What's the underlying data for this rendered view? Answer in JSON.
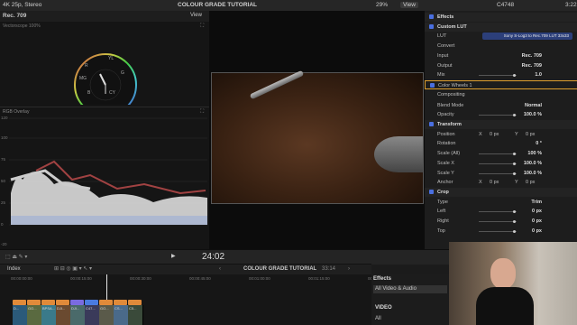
{
  "topbar": {
    "format": "4K 25p, Stereo",
    "title": "COLOUR GRADE TUTORIAL",
    "zoom": "29%",
    "view": "View",
    "clip_id": "C4748",
    "timecode": "3:22"
  },
  "scopes": {
    "label": "Rec. 709",
    "view": "View",
    "vectorscope_label": "Vectorscope 100%",
    "vector_marks": [
      "R",
      "YL",
      "G",
      "CY",
      "B",
      "MG"
    ],
    "rgb_overlay_label": "RGB Overlay",
    "y_ticks": [
      "120",
      "100",
      "75",
      "50",
      "25",
      "0",
      "-20"
    ]
  },
  "inspector": {
    "rows": [
      {
        "label": "Effects",
        "type": "hdr"
      },
      {
        "label": "Custom LUT",
        "type": "check"
      },
      {
        "label": "LUT",
        "value": "Sony S-Log3 to Rec.709 LUT 33x33"
      },
      {
        "label": "Convert",
        "type": "sub"
      },
      {
        "label": "Input",
        "value": "Rec. 709"
      },
      {
        "label": "Output",
        "value": "Rec. 709"
      },
      {
        "label": "Mix",
        "value": "1.0"
      },
      {
        "label": "Color Wheels 1",
        "type": "check-highlight"
      },
      {
        "label": "Compositing",
        "type": "hdr2"
      },
      {
        "label": "Blend Mode",
        "value": "Normal"
      },
      {
        "label": "Opacity",
        "value": "100.0 %"
      },
      {
        "label": "Transform",
        "type": "check"
      },
      {
        "label": "Position",
        "x": "0 px",
        "y": "0 px"
      },
      {
        "label": "Rotation",
        "value": "0 °"
      },
      {
        "label": "Scale (All)",
        "value": "100 %"
      },
      {
        "label": "Scale X",
        "value": "100.0 %"
      },
      {
        "label": "Scale Y",
        "value": "100.0 %"
      },
      {
        "label": "Anchor",
        "x": "0 px",
        "y": "0 px"
      },
      {
        "label": "Crop",
        "type": "check"
      },
      {
        "label": "Type",
        "value": "Trim"
      },
      {
        "label": "Left",
        "value": "0 px"
      },
      {
        "label": "Right",
        "value": "0 px"
      },
      {
        "label": "Top",
        "value": "0 px"
      }
    ]
  },
  "transport": {
    "timecode": "24:02",
    "index": "Index",
    "project": "COLOUR GRADE TUTORIAL",
    "duration": "33:14"
  },
  "ruler": [
    "00:00:00:00",
    "00:00:15:00",
    "00:00:30:00",
    "00:00:45:00",
    "00:01:00:00",
    "00:01:15:00",
    "00:01:30:00"
  ],
  "effects_panel": {
    "title": "Effects",
    "item": "All Video & Audio",
    "section": "VIDEO",
    "all": "All"
  },
  "clips": [
    "D...",
    "GO...",
    "BPSA...",
    "DJI...",
    "DJI...",
    "C47...",
    "GO...",
    "CS...",
    "C5..."
  ],
  "colors": {
    "accent": "#4a6fe0",
    "highlight": "#e0a030"
  }
}
